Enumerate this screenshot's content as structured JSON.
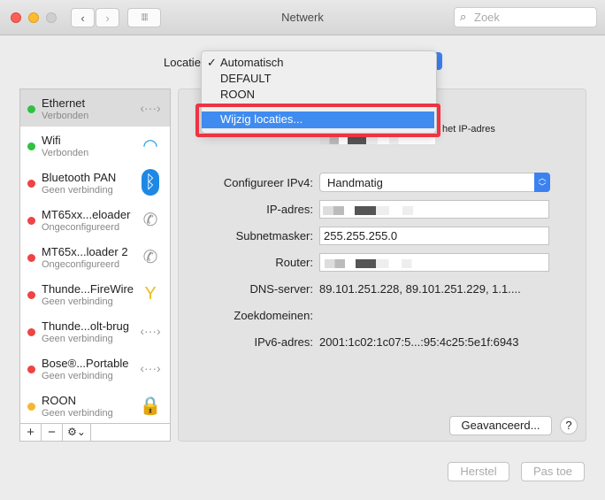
{
  "window": {
    "title": "Netwerk",
    "search_placeholder": "Zoek"
  },
  "location": {
    "label": "Locatie",
    "options": [
      "Automatisch",
      "DEFAULT",
      "ROON"
    ],
    "selected": "Automatisch",
    "edit": "Wijzig locaties..."
  },
  "services": [
    {
      "name": "Ethernet",
      "status": "Verbonden",
      "color": "#2fc13f",
      "icon": "ethernet-icon"
    },
    {
      "name": "Wifi",
      "status": "Verbonden",
      "color": "#2fc13f",
      "icon": "wifi-icon"
    },
    {
      "name": "Bluetooth PAN",
      "status": "Geen verbinding",
      "color": "#ee4444",
      "icon": "bluetooth-icon"
    },
    {
      "name": "MT65xx...eloader",
      "status": "Ongeconfigureerd",
      "color": "#ee4444",
      "icon": "phone-icon"
    },
    {
      "name": "MT65x...loader 2",
      "status": "Ongeconfigureerd",
      "color": "#ee4444",
      "icon": "phone-icon"
    },
    {
      "name": "Thunde...FireWire",
      "status": "Geen verbinding",
      "color": "#ee4444",
      "icon": "firewire-icon"
    },
    {
      "name": "Thunde...olt-brug",
      "status": "Geen verbinding",
      "color": "#ee4444",
      "icon": "ethernet-icon"
    },
    {
      "name": "Bose®...Portable",
      "status": "Geen verbinding",
      "color": "#ee4444",
      "icon": "ethernet-icon"
    },
    {
      "name": "ROON",
      "status": "Geen verbinding",
      "color": "#f5b731",
      "icon": "lock-icon"
    }
  ],
  "sidebar_footer": {
    "add": "+",
    "remove": "−",
    "gear": "⚙⌄"
  },
  "detail": {
    "status_partial": "het IP-adres",
    "configure_label": "Configureer IPv4:",
    "configure_value": "Handmatig",
    "ip_label": "IP-adres:",
    "subnet_label": "Subnetmasker:",
    "subnet_value": "255.255.255.0",
    "router_label": "Router:",
    "dns_label": "DNS-server:",
    "dns_value": "89.101.251.228, 89.101.251.229, 1.1....",
    "search_domains_label": "Zoekdomeinen:",
    "ipv6_label": "IPv6-adres:",
    "ipv6_value": "2001:1c02:1c07:5...:95:4c25:5e1f:6943",
    "advanced": "Geavanceerd...",
    "help": "?"
  },
  "footer": {
    "revert": "Herstel",
    "apply": "Pas toe"
  }
}
